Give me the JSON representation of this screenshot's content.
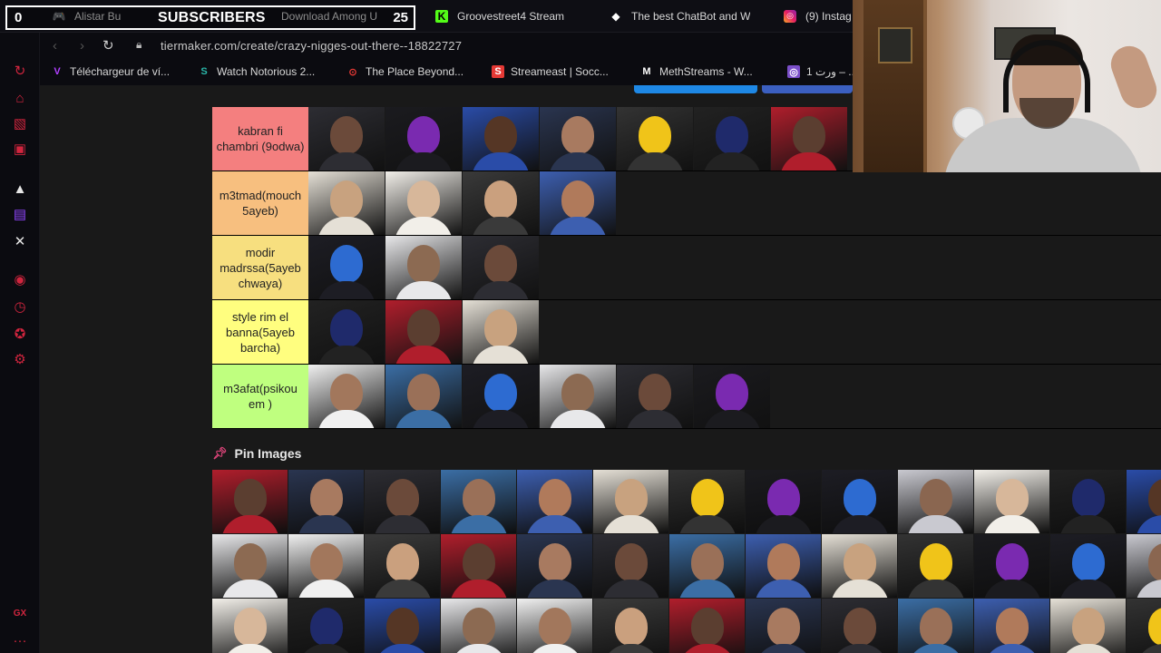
{
  "browser": {
    "overlay": {
      "left_count": "0",
      "label": "SUBSCRIBERS",
      "right_count": "25"
    },
    "tabs": [
      {
        "label": "Alistar Bu",
        "icon": "game-controller-icon"
      },
      {
        "label": "Download Among U",
        "icon": ""
      },
      {
        "label": "Groovestreet4 Stream",
        "icon": "kick-icon"
      },
      {
        "label": "The best ChatBot and W",
        "icon": "chatbot-icon"
      },
      {
        "label": "(9) Instag",
        "icon": "instagram-icon"
      }
    ],
    "url": "tiermaker.com/create/crazy-nigges-out-there--18822727",
    "bookmarks": [
      {
        "label": "Téléchargeur de ví...",
        "icon": "V"
      },
      {
        "label": "Watch Notorious 2...",
        "icon": "S"
      },
      {
        "label": "The Place Beyond...",
        "icon": "⊙"
      },
      {
        "label": "Streameast | Socc...",
        "icon": "S"
      },
      {
        "label": "MethStreams - W...",
        "icon": "M"
      },
      {
        "label": "1 ورت – ...",
        "icon": "◎"
      }
    ]
  },
  "tiers": [
    {
      "label": "kabran fi chambri (9odwa)",
      "color": "#f47f7f",
      "items": 7
    },
    {
      "label": "m3tmad(mouch 5ayeb)",
      "color": "#f7bf7f",
      "items": 4
    },
    {
      "label": "modir madrssa(5ayeb chwaya)",
      "color": "#f7df7f",
      "items": 3
    },
    {
      "label": "style rim el banna(5ayeb barcha)",
      "color": "#fffe7f",
      "items": 3
    },
    {
      "label": "m3afat(psikou em )",
      "color": "#bfff7f",
      "items": 6
    }
  ],
  "pin_images": {
    "title": "Pin Images",
    "count": 39
  }
}
